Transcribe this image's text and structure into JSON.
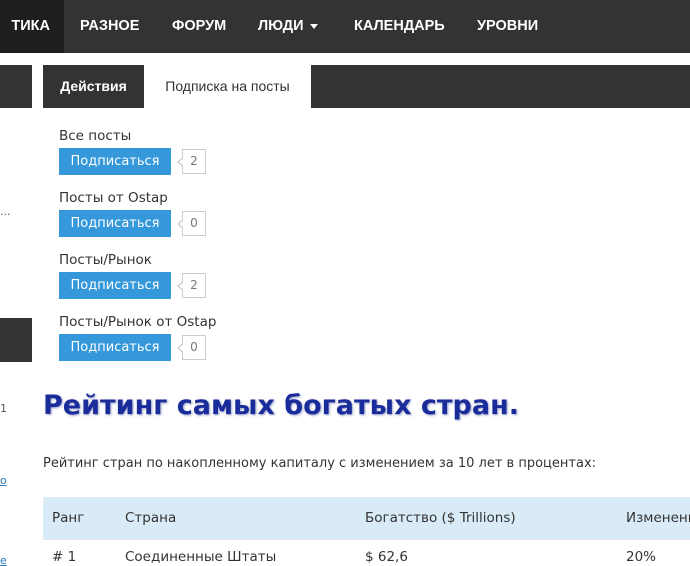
{
  "nav": {
    "items": [
      {
        "label": "ТИКА"
      },
      {
        "label": "РАЗНОЕ"
      },
      {
        "label": "ФОРУМ"
      },
      {
        "label": "ЛЮДИ"
      },
      {
        "label": "КАЛЕНДАРЬ"
      },
      {
        "label": "УРОВНИ"
      }
    ]
  },
  "left_fragments": {
    "dots": "...",
    "num": "1",
    "link": "o",
    "bottom": "e"
  },
  "tabs": {
    "actions": "Действия",
    "subscriptions": "Подписка на посты"
  },
  "subscriptions": [
    {
      "label": "Все посты",
      "button": "Подписаться",
      "count": "2"
    },
    {
      "label": "Посты от Ostap",
      "button": "Подписаться",
      "count": "0"
    },
    {
      "label": "Посты/Рынок",
      "button": "Подписаться",
      "count": "2"
    },
    {
      "label": "Посты/Рынок от Ostap",
      "button": "Подписаться",
      "count": "0"
    }
  ],
  "article": {
    "title": "Рейтинг самых богатых стран.",
    "description": "Рейтинг стран по накопленному капиталу с изменением за 10 лет в процентах:"
  },
  "table": {
    "headers": [
      "Ранг",
      "Страна",
      "Богатство ($ Trillions)",
      "Изменение"
    ],
    "rows": [
      [
        "# 1",
        "Соединенные Штаты",
        "$ 62,6",
        "20%"
      ]
    ]
  },
  "colors": {
    "nav_bg": "#333333",
    "button": "#3498db",
    "title": "#1a2b9a",
    "table_header": "#d9ebf7"
  }
}
